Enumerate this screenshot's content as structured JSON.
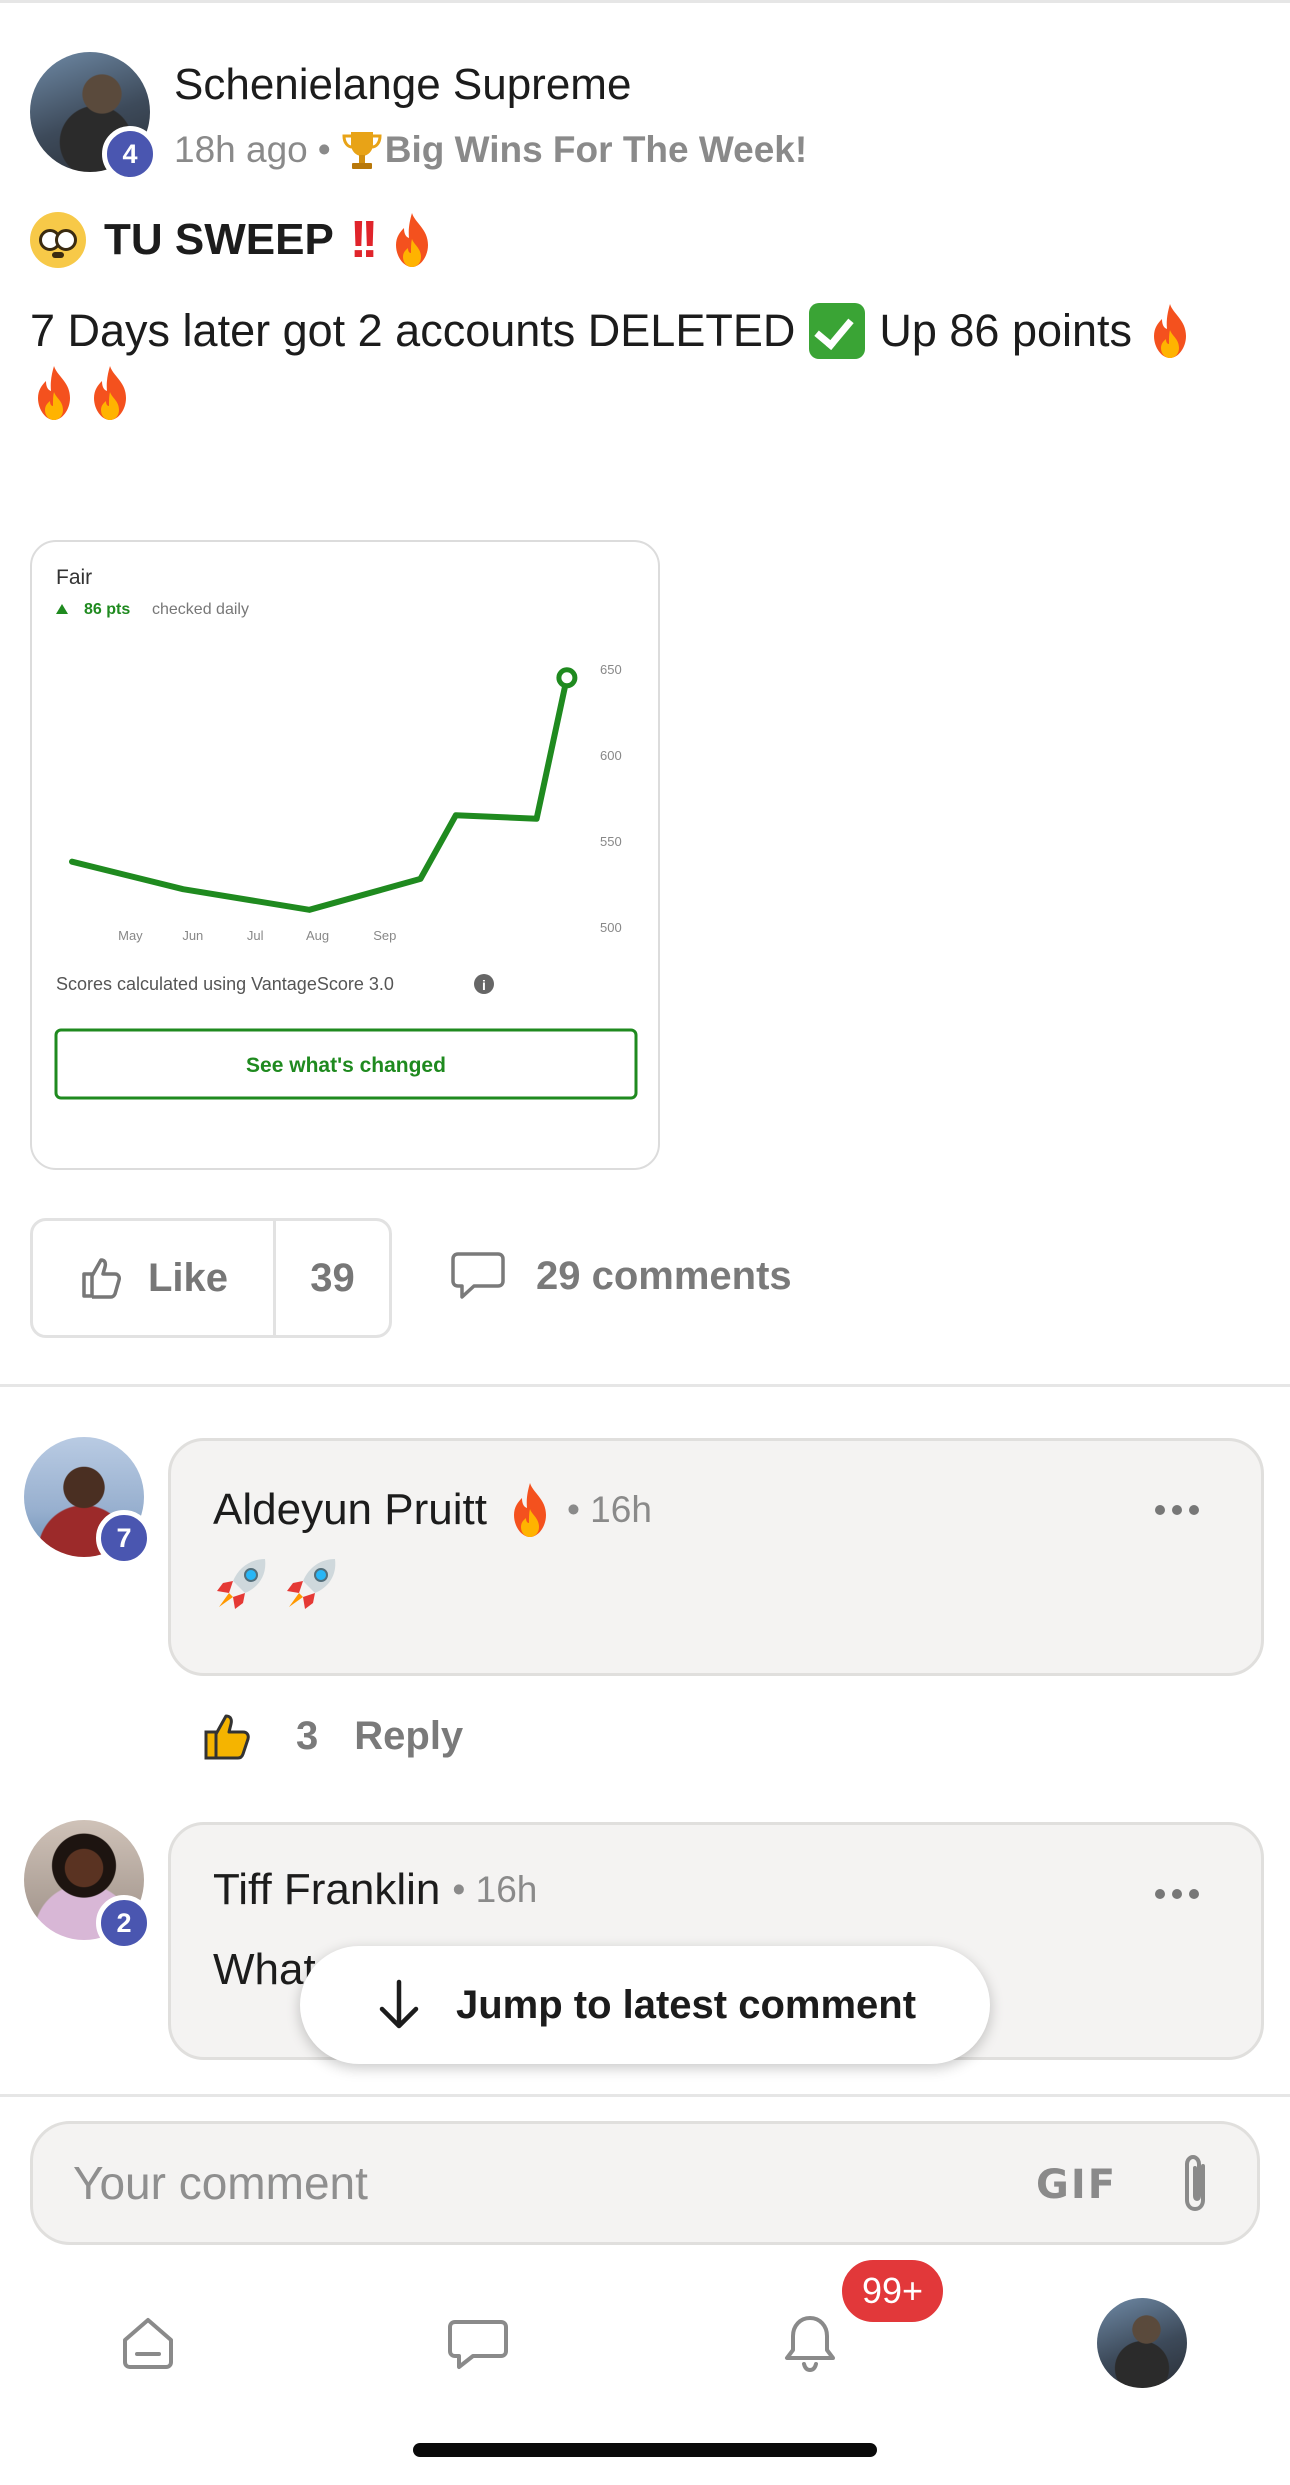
{
  "post": {
    "author": "Schenielange Supreme",
    "author_level": "4",
    "time": "18h ago",
    "separator": "•",
    "category": "Big Wins For The Week!",
    "title": "TU SWEEP",
    "body_line1": "7 Days later got 2 accounts DELETED",
    "body_line1_tail": "Up 86 points"
  },
  "attachment": {
    "status": "Fair",
    "change": "86 pts",
    "frequency": "checked daily",
    "footnote": "Scores calculated using VantageScore 3.0",
    "cta": "See what's changed",
    "line_color": "#1f8a1f",
    "chart_data": {
      "type": "line",
      "x": [
        "May",
        "Jun",
        "Jul",
        "Aug",
        "Sep",
        "Sep+"
      ],
      "x_ticks": [
        "May",
        "Jun",
        "Jul",
        "Aug",
        "Sep"
      ],
      "series": [
        {
          "values": [
            538,
            522,
            510,
            528,
            565,
            563,
            645
          ]
        }
      ],
      "y_ticks": [
        "650",
        "600",
        "550",
        "500"
      ],
      "ylim": [
        500,
        660
      ]
    }
  },
  "actions": {
    "like_label": "Like",
    "like_count": "39",
    "comments_label": "29 comments"
  },
  "comments": [
    {
      "name": "Aldeyun Pruitt",
      "level": "7",
      "time": "• 16h",
      "text": "",
      "likes": "3",
      "reply_label": "Reply"
    },
    {
      "name": "Tiff Franklin",
      "level": "2",
      "time": "• 16h",
      "text": "What"
    }
  ],
  "jump": {
    "label": "Jump to latest comment"
  },
  "composer": {
    "placeholder": "Your comment",
    "gif_label": "GIF"
  },
  "tabbar": {
    "notif_badge": "99+"
  },
  "colors": {
    "level_badge": "#4a56b0",
    "notif_badge": "#e2383a",
    "accent_green": "#1f8a1f"
  }
}
